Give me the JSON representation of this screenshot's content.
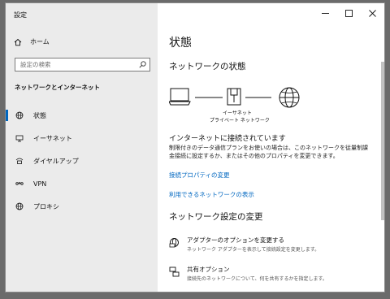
{
  "window": {
    "title": "設定",
    "controls": {
      "minimize": "—",
      "maximize": "☐",
      "close": "✕"
    }
  },
  "sidebar": {
    "home_label": "ホーム",
    "search_placeholder": "設定の検索",
    "section_title": "ネットワークとインターネット",
    "items": [
      {
        "label": "状態",
        "icon": "globe-network-icon",
        "active": true
      },
      {
        "label": "イーサネット",
        "icon": "ethernet-icon",
        "active": false
      },
      {
        "label": "ダイヤルアップ",
        "icon": "dialup-icon",
        "active": false
      },
      {
        "label": "VPN",
        "icon": "vpn-icon",
        "active": false
      },
      {
        "label": "プロキシ",
        "icon": "proxy-globe-icon",
        "active": false
      }
    ]
  },
  "main": {
    "page_title": "状態",
    "network_status_heading": "ネットワークの状態",
    "diagram": {
      "caption1": "イーサネット",
      "caption2": "プライベート ネットワーク"
    },
    "connected_heading": "インターネットに接続されています",
    "connected_desc": "制限付きのデータ通信プランをお使いの場合は、このネットワークを従量制課金接続に設定するか、またはその他のプロパティを変更できます。",
    "link_properties": "接続プロパティの変更",
    "link_available": "利用できるネットワークの表示",
    "settings_heading": "ネットワーク設定の変更",
    "options": [
      {
        "title": "アダプターのオプションを変更する",
        "desc": "ネットワーク アダプターを表示して接続設定を変更します。",
        "icon": "adapter-icon"
      },
      {
        "title": "共有オプション",
        "desc": "接続先のネットワークについて、何を共有するかを指定します。",
        "icon": "sharing-icon"
      }
    ]
  },
  "colors": {
    "accent": "#0067c0",
    "sidebar_bg": "#ebebeb"
  }
}
